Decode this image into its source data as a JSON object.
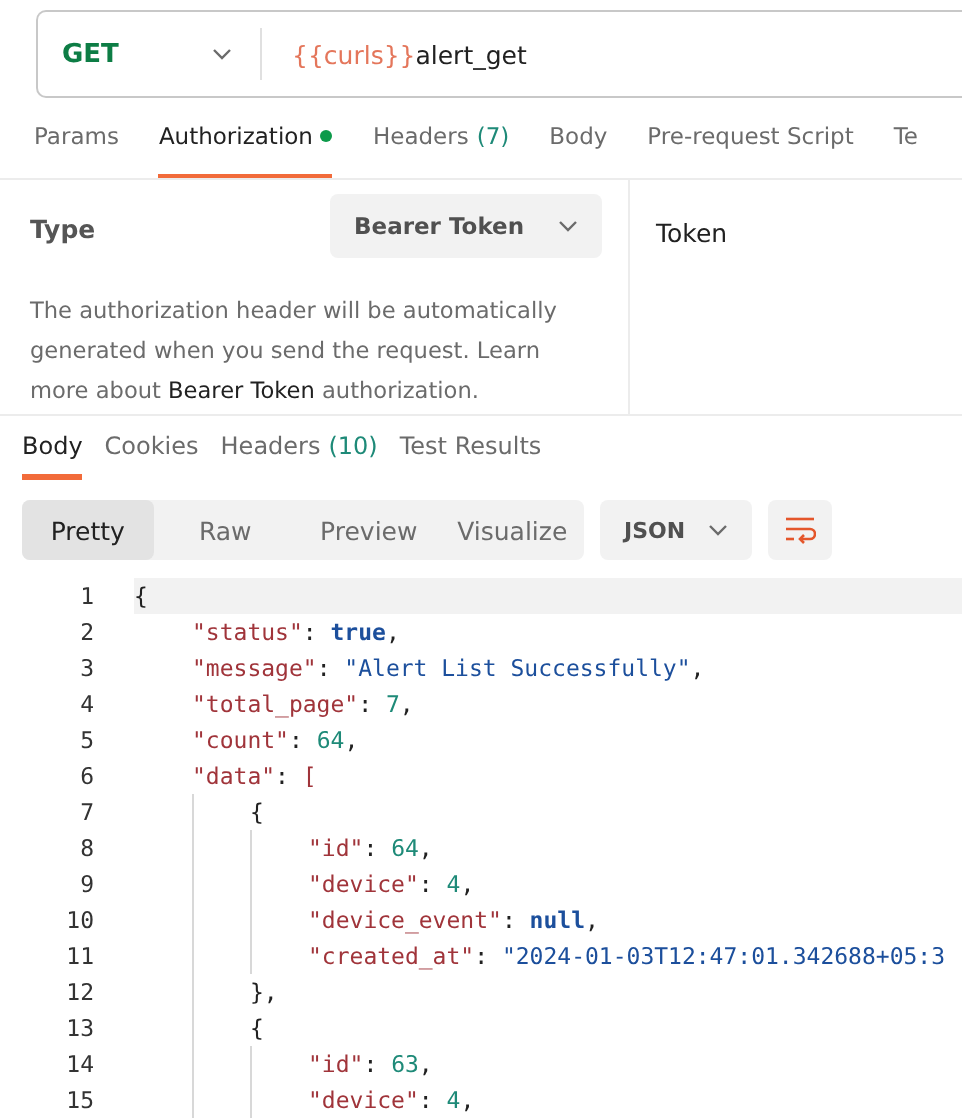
{
  "request": {
    "method": "GET",
    "url_variable": "{{curls}}",
    "url_path": "alert_get"
  },
  "request_tabs": [
    {
      "label": "Params",
      "dot": false,
      "selected": false
    },
    {
      "label": "Authorization",
      "dot": true,
      "selected": true
    },
    {
      "label": "Headers",
      "count": "(7)",
      "dot": false,
      "selected": false
    },
    {
      "label": "Body",
      "dot": false,
      "selected": false
    },
    {
      "label": "Pre-request Script",
      "dot": false,
      "selected": false
    },
    {
      "label": "Te",
      "dot": false,
      "selected": false
    }
  ],
  "authorization": {
    "type_label": "Type",
    "type_value": "Bearer Token",
    "description": "The authorization header will be automatically generated when you send the request. Learn more about **Bearer Token** authorization.",
    "token_label": "Token"
  },
  "response_tabs": [
    {
      "label": "Body",
      "selected": true
    },
    {
      "label": "Cookies",
      "selected": false
    },
    {
      "label": "Headers",
      "count": "(10)",
      "selected": false
    },
    {
      "label": "Test Results",
      "selected": false
    }
  ],
  "view_modes": [
    {
      "label": "Pretty",
      "selected": true
    },
    {
      "label": "Raw",
      "selected": false
    },
    {
      "label": "Preview",
      "selected": false
    },
    {
      "label": "Visualize",
      "selected": false
    }
  ],
  "format": "JSON",
  "code_lines": [
    {
      "number": "1",
      "current": true,
      "tokens": [
        {
          "kind": "punct",
          "text": "{"
        }
      ],
      "children": [
        {
          "number": "2",
          "current": false,
          "tokens": [
            {
              "kind": "key",
              "text": "\"status\""
            },
            {
              "kind": "punct",
              "text": ": "
            },
            {
              "kind": "keyword",
              "text": "true"
            },
            {
              "kind": "punct",
              "text": ","
            }
          ]
        },
        {
          "number": "3",
          "current": false,
          "tokens": [
            {
              "kind": "key",
              "text": "\"message\""
            },
            {
              "kind": "punct",
              "text": ": "
            },
            {
              "kind": "string",
              "text": "\"Alert List Successfully\""
            },
            {
              "kind": "punct",
              "text": ","
            }
          ]
        },
        {
          "number": "4",
          "current": false,
          "tokens": [
            {
              "kind": "key",
              "text": "\"total_page\""
            },
            {
              "kind": "punct",
              "text": ": "
            },
            {
              "kind": "number",
              "text": "7"
            },
            {
              "kind": "punct",
              "text": ","
            }
          ]
        },
        {
          "number": "5",
          "current": false,
          "tokens": [
            {
              "kind": "key",
              "text": "\"count\""
            },
            {
              "kind": "punct",
              "text": ": "
            },
            {
              "kind": "number",
              "text": "64"
            },
            {
              "kind": "punct",
              "text": ","
            }
          ]
        },
        {
          "number": "6",
          "current": false,
          "tokens": [
            {
              "kind": "key",
              "text": "\"data\""
            },
            {
              "kind": "punct",
              "text": ": "
            },
            {
              "kind": "bracket",
              "text": "["
            }
          ],
          "children": [
            {
              "number": "7",
              "current": false,
              "tokens": [
                {
                  "kind": "punct",
                  "text": "{"
                }
              ],
              "children": [
                {
                  "number": "8",
                  "current": false,
                  "tokens": [
                    {
                      "kind": "key",
                      "text": "\"id\""
                    },
                    {
                      "kind": "punct",
                      "text": ": "
                    },
                    {
                      "kind": "number",
                      "text": "64"
                    },
                    {
                      "kind": "punct",
                      "text": ","
                    }
                  ]
                },
                {
                  "number": "9",
                  "current": false,
                  "tokens": [
                    {
                      "kind": "key",
                      "text": "\"device\""
                    },
                    {
                      "kind": "punct",
                      "text": ": "
                    },
                    {
                      "kind": "number",
                      "text": "4"
                    },
                    {
                      "kind": "punct",
                      "text": ","
                    }
                  ]
                },
                {
                  "number": "10",
                  "current": false,
                  "tokens": [
                    {
                      "kind": "key",
                      "text": "\"device_event\""
                    },
                    {
                      "kind": "punct",
                      "text": ": "
                    },
                    {
                      "kind": "keyword",
                      "text": "null"
                    },
                    {
                      "kind": "punct",
                      "text": ","
                    }
                  ]
                },
                {
                  "number": "11",
                  "current": false,
                  "tokens": [
                    {
                      "kind": "key",
                      "text": "\"created_at\""
                    },
                    {
                      "kind": "punct",
                      "text": ": "
                    },
                    {
                      "kind": "string",
                      "text": "\"2024-01-03T12:47:01.342688+05:3"
                    }
                  ]
                }
              ]
            },
            {
              "number": "12",
              "current": false,
              "tokens": [
                {
                  "kind": "punct",
                  "text": "},"
                }
              ]
            },
            {
              "number": "13",
              "current": false,
              "tokens": [
                {
                  "kind": "punct",
                  "text": "{"
                }
              ],
              "children": [
                {
                  "number": "14",
                  "current": false,
                  "tokens": [
                    {
                      "kind": "key",
                      "text": "\"id\""
                    },
                    {
                      "kind": "punct",
                      "text": ": "
                    },
                    {
                      "kind": "number",
                      "text": "63"
                    },
                    {
                      "kind": "punct",
                      "text": ","
                    }
                  ]
                },
                {
                  "number": "15",
                  "current": false,
                  "tokens": [
                    {
                      "kind": "key",
                      "text": "\"device\""
                    },
                    {
                      "kind": "punct",
                      "text": ": "
                    },
                    {
                      "kind": "number",
                      "text": "4"
                    },
                    {
                      "kind": "punct",
                      "text": ","
                    }
                  ]
                }
              ]
            }
          ]
        }
      ]
    }
  ]
}
